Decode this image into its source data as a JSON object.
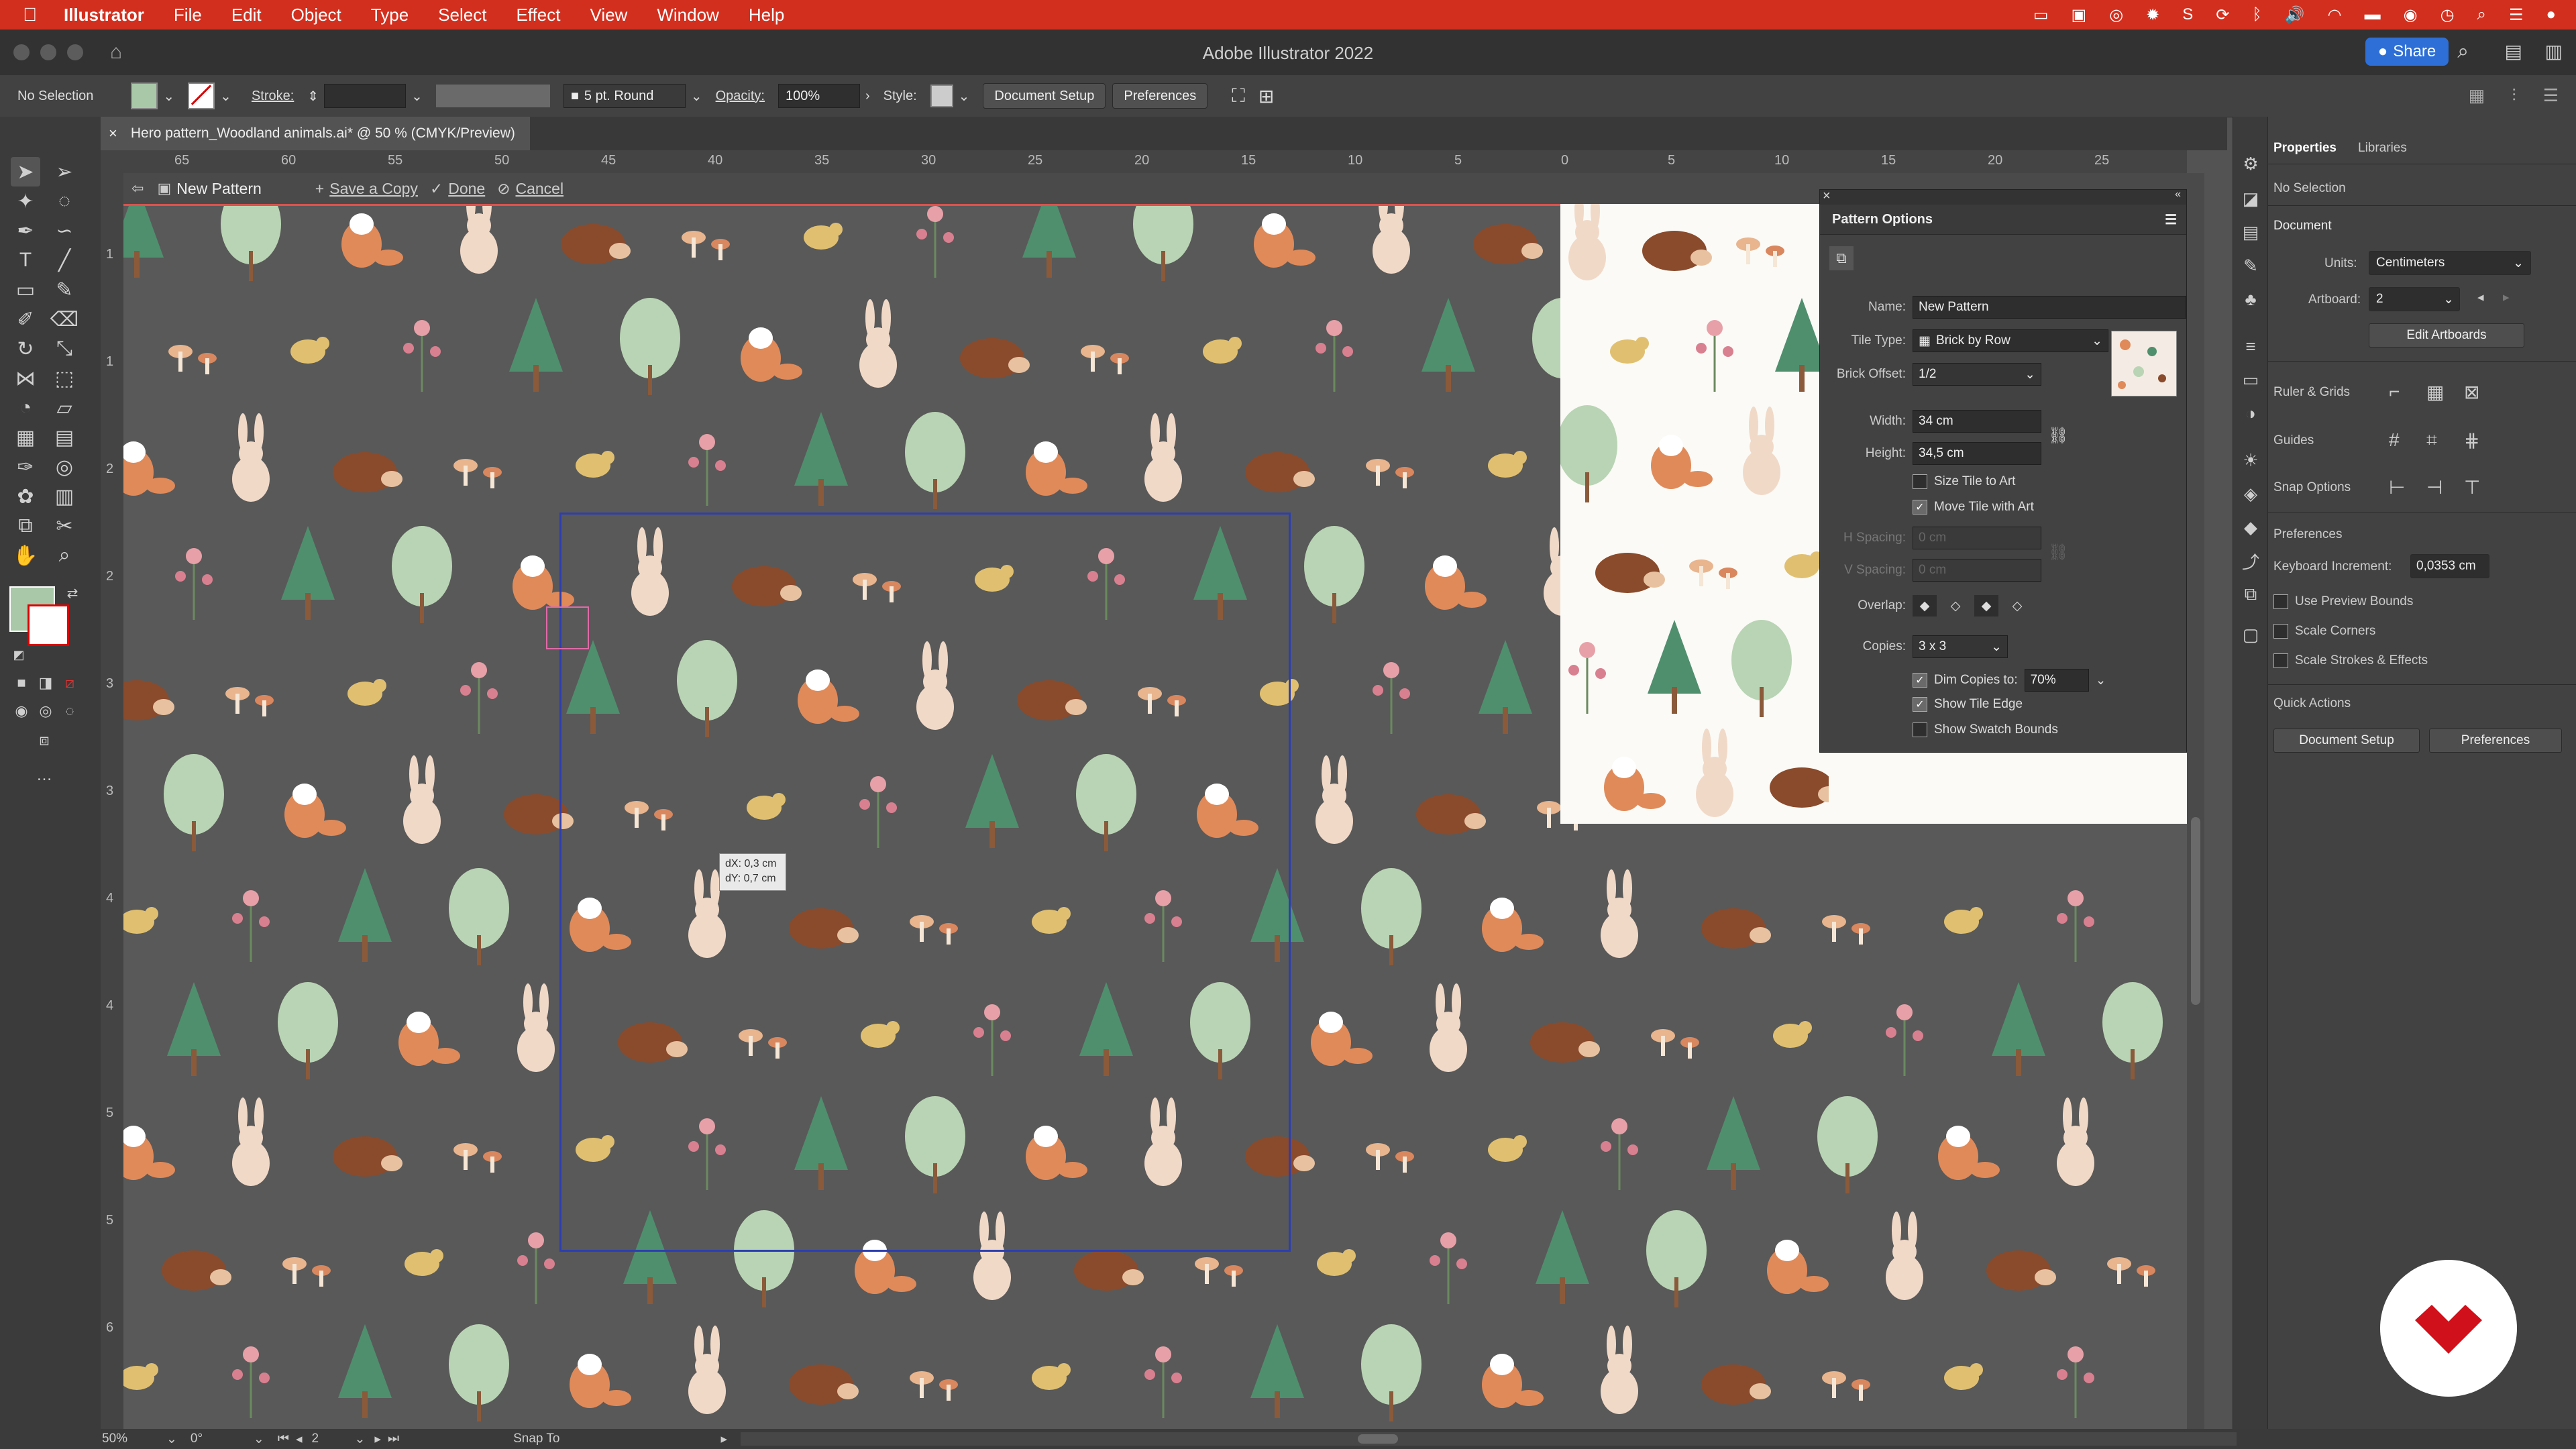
{
  "menubar": {
    "app_name": "Illustrator",
    "items": [
      "File",
      "Edit",
      "Object",
      "Type",
      "Select",
      "Effect",
      "View",
      "Window",
      "Help"
    ]
  },
  "window": {
    "title": "Adobe Illustrator 2022",
    "share_label": "Share"
  },
  "controlbar": {
    "selection": "No Selection",
    "stroke_label": "Stroke:",
    "brush": "5 pt. Round",
    "opacity_label": "Opacity:",
    "opacity_value": "100%",
    "style_label": "Style:",
    "document_setup": "Document Setup",
    "preferences": "Preferences"
  },
  "document_tab": {
    "title": "Hero pattern_Woodland animals.ai* @ 50 % (CMYK/Preview)"
  },
  "ruler": {
    "h_ticks": [
      "65",
      "60",
      "55",
      "50",
      "45",
      "40",
      "35",
      "30",
      "25",
      "20",
      "15",
      "10",
      "5",
      "0",
      "5",
      "10",
      "15",
      "20",
      "25"
    ],
    "v_ticks": [
      "1",
      "1",
      "2",
      "2",
      "3",
      "3",
      "4",
      "4",
      "5",
      "5",
      "6"
    ]
  },
  "pattern_bar": {
    "name": "New Pattern",
    "save_copy": "Save a Copy",
    "done": "Done",
    "cancel": "Cancel"
  },
  "measure_tooltip": {
    "dx": "dX: 0,3 cm",
    "dy": "dY: 0,7 cm"
  },
  "pattern_options": {
    "title": "Pattern Options",
    "name_label": "Name:",
    "name_value": "New Pattern",
    "tile_type_label": "Tile Type:",
    "tile_type_value": "Brick by Row",
    "brick_offset_label": "Brick Offset:",
    "brick_offset_value": "1/2",
    "width_label": "Width:",
    "width_value": "34 cm",
    "height_label": "Height:",
    "height_value": "34,5 cm",
    "size_tile_to_art": "Size Tile to Art",
    "move_tile_with_art": "Move Tile with Art",
    "h_spacing_label": "H Spacing:",
    "v_spacing_label": "V Spacing:",
    "spacing_value": "0 cm",
    "overlap_label": "Overlap:",
    "copies_label": "Copies:",
    "copies_value": "3 x 3",
    "dim_copies": "Dim Copies to:",
    "dim_value": "70%",
    "show_tile_edge": "Show Tile Edge",
    "show_swatch_bounds": "Show Swatch Bounds",
    "size_tile_checked": false,
    "move_tile_checked": true,
    "dim_copies_checked": true,
    "show_tile_edge_checked": true,
    "show_swatch_bounds_checked": false
  },
  "properties": {
    "tab_properties": "Properties",
    "tab_libraries": "Libraries",
    "no_selection": "No Selection",
    "document_title": "Document",
    "units_label": "Units:",
    "units_value": "Centimeters",
    "artboard_label": "Artboard:",
    "artboard_value": "2",
    "edit_artboards": "Edit Artboards",
    "ruler_grids": "Ruler & Grids",
    "guides": "Guides",
    "snap_options": "Snap Options",
    "preferences_title": "Preferences",
    "keyboard_increment_label": "Keyboard Increment:",
    "keyboard_increment_value": "0,0353 cm",
    "use_preview_bounds": "Use Preview Bounds",
    "scale_corners": "Scale Corners",
    "scale_strokes": "Scale Strokes & Effects",
    "quick_actions": "Quick Actions",
    "document_setup": "Document Setup",
    "preferences_btn": "Preferences"
  },
  "statusbar": {
    "zoom": "50%",
    "rotation": "0°",
    "artboard": "2",
    "snap": "Snap To"
  },
  "colors": {
    "menubar": "#d32f1e",
    "canvas": "#595959",
    "tile_border": "#2c3eb0",
    "accent": "#2d6fd6",
    "fox": "#e08a5a",
    "tree_green": "#4f8f6e",
    "leaf_tree": "#b9d4b4",
    "bunny": "#f1d9c8",
    "hedgehog": "#8a4b2c"
  }
}
